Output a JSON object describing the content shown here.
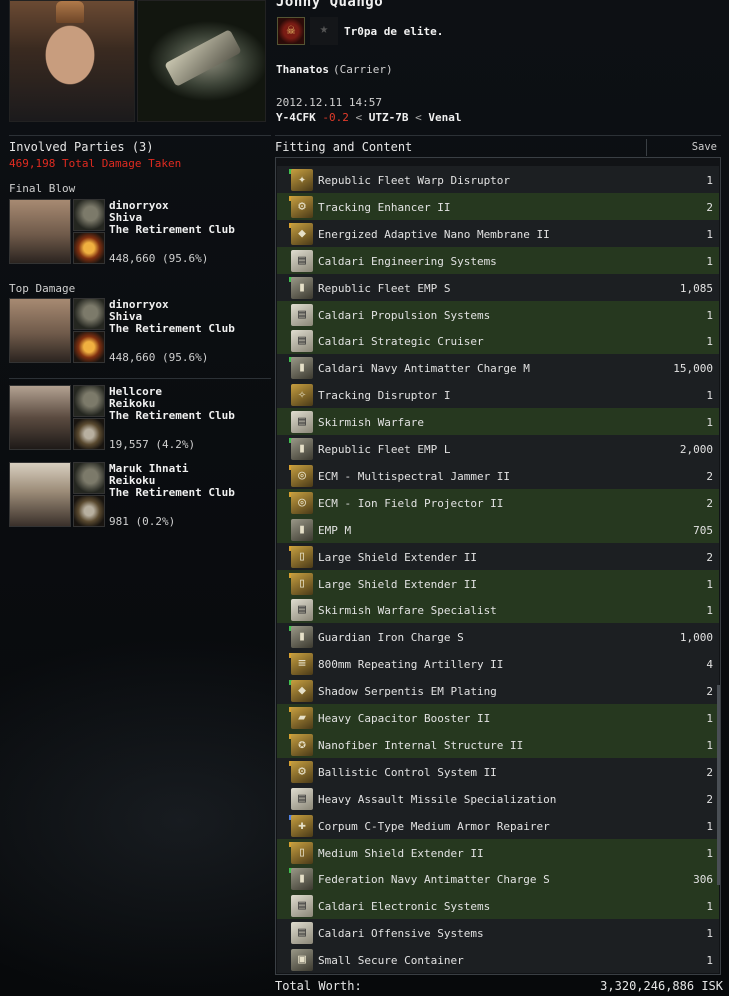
{
  "header": {
    "pilot_name": "Jonny Quango",
    "corp_name": "Tr0pa de elite.",
    "ship_name": "Thanatos",
    "ship_class": "(Carrier)",
    "date": "2012.12.11 14:57",
    "location": {
      "system": "Y-4CFK",
      "security": "-0.2",
      "constellation": "UTZ-7B",
      "region": "Venal",
      "separator": "<"
    }
  },
  "involved": {
    "title": "Involved Parties (3)",
    "total_damage": "469,198 Total Damage Taken",
    "final_blow_label": "Final Blow",
    "top_damage_label": "Top Damage",
    "final_blow": {
      "name": "dinorryox",
      "ship": "Shiva",
      "corp": "The Retirement Club",
      "damage": "448,660 (95.6%)"
    },
    "top_damage": {
      "name": "dinorryox",
      "ship": "Shiva",
      "corp": "The Retirement Club",
      "damage": "448,660 (95.6%)"
    },
    "others": [
      {
        "name": "Hellcore",
        "ship": "Reikoku",
        "corp": "The Retirement Club",
        "damage": "19,557 (4.2%)"
      },
      {
        "name": "Maruk Ihnati",
        "ship": "Reikoku",
        "corp": "The Retirement Club",
        "damage": "981 (0.2%)"
      }
    ]
  },
  "fitting": {
    "title": "Fitting and Content",
    "save_label": "Save Fitting",
    "items": [
      {
        "name": "Republic Fleet Warp Disruptor",
        "qty": "1",
        "style": "odd",
        "icon": "warp-disruptor-icon",
        "glyph": "✦",
        "kind": "mod",
        "tag": "green"
      },
      {
        "name": "Tracking Enhancer II",
        "qty": "2",
        "style": "fitted",
        "icon": "tracking-enhancer-icon",
        "glyph": "⚙",
        "kind": "mod",
        "tag": "gold"
      },
      {
        "name": "Energized Adaptive Nano Membrane II",
        "qty": "1",
        "style": "odd",
        "icon": "armor-membrane-icon",
        "glyph": "◆",
        "kind": "mod",
        "tag": "gold"
      },
      {
        "name": "Caldari Engineering Systems",
        "qty": "1",
        "style": "fitted",
        "icon": "skillbook-icon",
        "glyph": "▤",
        "kind": "book",
        "tag": ""
      },
      {
        "name": "Republic Fleet EMP S",
        "qty": "1,085",
        "style": "odd",
        "icon": "ammo-icon",
        "glyph": "▮",
        "kind": "ammo",
        "tag": "green"
      },
      {
        "name": "Caldari Propulsion Systems",
        "qty": "1",
        "style": "fitted",
        "icon": "skillbook-icon",
        "glyph": "▤",
        "kind": "book",
        "tag": ""
      },
      {
        "name": "Caldari Strategic Cruiser",
        "qty": "1",
        "style": "fitted",
        "icon": "skillbook-icon",
        "glyph": "▤",
        "kind": "book",
        "tag": ""
      },
      {
        "name": "Caldari Navy Antimatter Charge M",
        "qty": "15,000",
        "style": "odd",
        "icon": "ammo-icon",
        "glyph": "▮",
        "kind": "ammo",
        "tag": "green"
      },
      {
        "name": "Tracking Disruptor I",
        "qty": "1",
        "style": "odd",
        "icon": "tracking-disruptor-icon",
        "glyph": "✧",
        "kind": "mod",
        "tag": ""
      },
      {
        "name": "Skirmish Warfare",
        "qty": "1",
        "style": "fitted",
        "icon": "skillbook-icon",
        "glyph": "▤",
        "kind": "book",
        "tag": ""
      },
      {
        "name": "Republic Fleet EMP L",
        "qty": "2,000",
        "style": "odd",
        "icon": "ammo-icon",
        "glyph": "▮",
        "kind": "ammo",
        "tag": "green"
      },
      {
        "name": "ECM - Multispectral Jammer II",
        "qty": "2",
        "style": "odd",
        "icon": "ecm-jammer-icon",
        "glyph": "◎",
        "kind": "mod",
        "tag": "gold"
      },
      {
        "name": "ECM - Ion Field Projector II",
        "qty": "2",
        "style": "fitted",
        "icon": "ecm-projector-icon",
        "glyph": "◎",
        "kind": "mod",
        "tag": "gold"
      },
      {
        "name": "EMP M",
        "qty": "705",
        "style": "fitted",
        "icon": "ammo-icon",
        "glyph": "▮",
        "kind": "ammo",
        "tag": ""
      },
      {
        "name": "Large Shield Extender II",
        "qty": "2",
        "style": "odd",
        "icon": "shield-extender-icon",
        "glyph": "▯",
        "kind": "mod",
        "tag": "gold"
      },
      {
        "name": "Large Shield Extender II",
        "qty": "1",
        "style": "fitted",
        "icon": "shield-extender-icon",
        "glyph": "▯",
        "kind": "mod",
        "tag": "gold"
      },
      {
        "name": "Skirmish Warfare Specialist",
        "qty": "1",
        "style": "fitted",
        "icon": "skillbook-icon",
        "glyph": "▤",
        "kind": "book",
        "tag": ""
      },
      {
        "name": "Guardian Iron Charge S",
        "qty": "1,000",
        "style": "odd",
        "icon": "ammo-icon",
        "glyph": "▮",
        "kind": "ammo",
        "tag": "green"
      },
      {
        "name": "800mm Repeating Artillery II",
        "qty": "4",
        "style": "odd",
        "icon": "artillery-icon",
        "glyph": "≡",
        "kind": "mod",
        "tag": "gold"
      },
      {
        "name": "Shadow Serpentis EM Plating",
        "qty": "2",
        "style": "odd",
        "icon": "armor-plating-icon",
        "glyph": "◆",
        "kind": "mod",
        "tag": "green"
      },
      {
        "name": "Heavy Capacitor Booster II",
        "qty": "1",
        "style": "fitted",
        "icon": "capacitor-booster-icon",
        "glyph": "▰",
        "kind": "mod",
        "tag": "gold"
      },
      {
        "name": "Nanofiber Internal Structure II",
        "qty": "1",
        "style": "fitted",
        "icon": "nanofiber-icon",
        "glyph": "✪",
        "kind": "mod",
        "tag": "gold"
      },
      {
        "name": "Ballistic Control System II",
        "qty": "2",
        "style": "odd",
        "icon": "ballistic-control-icon",
        "glyph": "⚙",
        "kind": "mod",
        "tag": "gold"
      },
      {
        "name": "Heavy Assault Missile Specialization",
        "qty": "2",
        "style": "odd",
        "icon": "skillbook-icon",
        "glyph": "▤",
        "kind": "book",
        "tag": ""
      },
      {
        "name": "Corpum C-Type Medium Armor Repairer",
        "qty": "1",
        "style": "odd",
        "icon": "armor-repairer-icon",
        "glyph": "✚",
        "kind": "mod",
        "tag": "blue"
      },
      {
        "name": "Medium Shield Extender II",
        "qty": "1",
        "style": "fitted",
        "icon": "shield-extender-icon",
        "glyph": "▯",
        "kind": "mod",
        "tag": "gold"
      },
      {
        "name": "Federation Navy Antimatter Charge S",
        "qty": "306",
        "style": "fitted",
        "icon": "ammo-icon",
        "glyph": "▮",
        "kind": "ammo",
        "tag": "green"
      },
      {
        "name": "Caldari Electronic Systems",
        "qty": "1",
        "style": "fitted",
        "icon": "skillbook-icon",
        "glyph": "▤",
        "kind": "book",
        "tag": ""
      },
      {
        "name": "Caldari Offensive Systems",
        "qty": "1",
        "style": "odd",
        "icon": "skillbook-icon",
        "glyph": "▤",
        "kind": "book",
        "tag": ""
      },
      {
        "name": "Small Secure Container",
        "qty": "1",
        "style": "odd",
        "icon": "container-icon",
        "glyph": "▣",
        "kind": "ammo",
        "tag": ""
      }
    ]
  },
  "total": {
    "label": "Total Worth:",
    "value": "3,320,246,886 ISK"
  },
  "colors": {
    "fitted_row": "#26381f",
    "odd_row": "#1c1f22",
    "negative_sec": "#e23b2a",
    "damage_red": "#e02b20"
  }
}
